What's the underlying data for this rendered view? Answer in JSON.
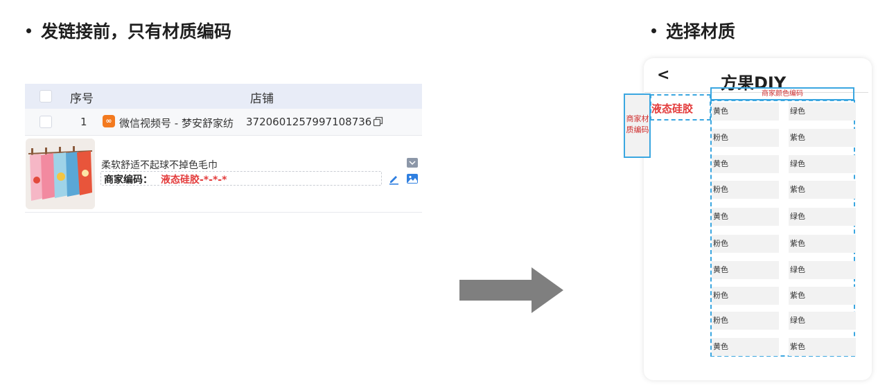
{
  "left_title": "发链接前，只有材质编码",
  "right_title": "选择材质",
  "table": {
    "header": {
      "col_no": "序号",
      "col_shop": "店铺"
    },
    "row": {
      "no": "1",
      "shop_icon": "weixin-channels-icon",
      "shop_name": "微信视频号 - 梦安舒家纺",
      "shop_id": "3720601257997108736"
    },
    "product": {
      "name": "柔软舒适不起球不掉色毛巾",
      "code_label": "商家编码：",
      "code_value": "液态硅胶-*-*-*"
    }
  },
  "phone": {
    "back": "<",
    "title": "方果DIY",
    "merchant_material_code": "商家材质编码",
    "material": "液态硅胶",
    "merchant_color_code": "商家颜色编码",
    "rows": [
      [
        "黄色",
        "绿色"
      ],
      [
        "粉色",
        "紫色"
      ],
      [
        "黄色",
        "绿色"
      ],
      [
        "粉色",
        "紫色"
      ],
      [
        "黄色",
        "绿色"
      ],
      [
        "粉色",
        "紫色"
      ],
      [
        "黄色",
        "绿色"
      ],
      [
        "粉色",
        "紫色"
      ],
      [
        "粉色",
        "绿色"
      ],
      [
        "黄色",
        "紫色"
      ]
    ]
  },
  "colors": {
    "accent_blue": "#3aa6e0",
    "highlight_red": "#e33b3b",
    "arrow_gray": "#7f7f7f",
    "header_bg": "#e8ecf7"
  }
}
